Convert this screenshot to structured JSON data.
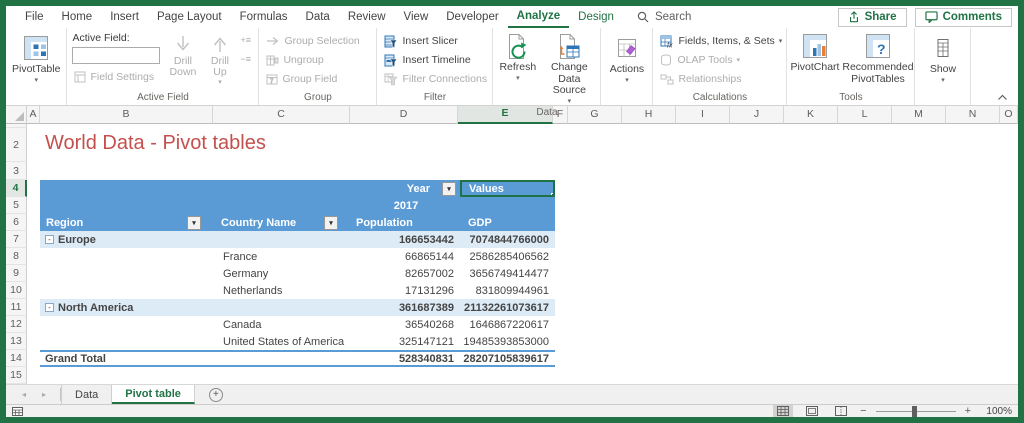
{
  "menu": {
    "tabs": [
      {
        "label": "File"
      },
      {
        "label": "Home"
      },
      {
        "label": "Insert"
      },
      {
        "label": "Page Layout"
      },
      {
        "label": "Formulas"
      },
      {
        "label": "Data"
      },
      {
        "label": "Review"
      },
      {
        "label": "View"
      },
      {
        "label": "Developer"
      },
      {
        "label": "Analyze",
        "active": true
      },
      {
        "label": "Design",
        "contextual": true
      }
    ],
    "search_label": "Search",
    "share_label": "Share",
    "comments_label": "Comments"
  },
  "ribbon": {
    "pivottable": {
      "label": "PivotTable",
      "enabled": true
    },
    "active_field": {
      "group_label": "Active Field",
      "field_label": "Active Field:",
      "field_value": "",
      "field_settings": "Field Settings",
      "field_settings_enabled": false,
      "drill_down": "Drill Down",
      "drill_down_enabled": false,
      "drill_up": "Drill Up",
      "drill_up_enabled": false,
      "expand_field_enabled": false,
      "collapse_field_enabled": false
    },
    "group": {
      "group_label": "Group",
      "selection": "Group Selection",
      "selection_enabled": false,
      "ungroup": "Ungroup",
      "ungroup_enabled": false,
      "field": "Group Field",
      "field_enabled": false
    },
    "filter": {
      "group_label": "Filter",
      "insert_slicer": "Insert Slicer",
      "insert_slicer_enabled": true,
      "insert_timeline": "Insert Timeline",
      "insert_timeline_enabled": true,
      "filter_connections": "Filter Connections",
      "filter_connections_enabled": false
    },
    "data": {
      "group_label": "Data",
      "refresh": "Refresh",
      "refresh_enabled": true,
      "change_data_source": "Change Data Source",
      "change_data_source_enabled": true
    },
    "actions": {
      "label": "Actions",
      "enabled": true
    },
    "calculations": {
      "group_label": "Calculations",
      "fields_items_sets": "Fields, Items, & Sets",
      "fields_items_sets_enabled": true,
      "olap_tools": "OLAP Tools",
      "olap_tools_enabled": false,
      "relationships": "Relationships",
      "relationships_enabled": false
    },
    "tools": {
      "group_label": "Tools",
      "pivotchart": "PivotChart",
      "recommended": "Recommended PivotTables"
    },
    "show": {
      "label": "Show"
    }
  },
  "sheet": {
    "column_headers": [
      "A",
      "B",
      "C",
      "D",
      "E",
      "F",
      "G",
      "H",
      "I",
      "J",
      "K",
      "L",
      "M",
      "N",
      "O"
    ],
    "selected_column": "E",
    "row_numbers": [
      "2",
      "3",
      "4",
      "5",
      "6",
      "7",
      "8",
      "9",
      "10",
      "11",
      "12",
      "13",
      "14",
      "15"
    ],
    "selected_row": "4",
    "title": "World Data - Pivot tables"
  },
  "pivot": {
    "year_label": "Year",
    "values_label": "Values",
    "year_value": "2017",
    "headers": {
      "region": "Region",
      "country": "Country Name",
      "population": "Population",
      "gdp": "GDP"
    },
    "rows": [
      {
        "type": "subtotal",
        "region": "Europe",
        "country": "",
        "population": "166653442",
        "gdp": "7074844766000"
      },
      {
        "type": "detail",
        "region": "",
        "country": "France",
        "population": "66865144",
        "gdp": "2586285406562"
      },
      {
        "type": "detail",
        "region": "",
        "country": "Germany",
        "population": "82657002",
        "gdp": "3656749414477"
      },
      {
        "type": "detail",
        "region": "",
        "country": "Netherlands",
        "population": "17131296",
        "gdp": "831809944961"
      },
      {
        "type": "subtotal",
        "region": "North America",
        "country": "",
        "population": "361687389",
        "gdp": "21132261073617"
      },
      {
        "type": "detail",
        "region": "",
        "country": "Canada",
        "population": "36540268",
        "gdp": "1646867220617"
      },
      {
        "type": "detail",
        "region": "",
        "country": "United States of America",
        "population": "325147121",
        "gdp": "19485393853000"
      },
      {
        "type": "grand",
        "region": "Grand Total",
        "country": "",
        "population": "528340831",
        "gdp": "28207105839617"
      }
    ]
  },
  "sheet_tabs": {
    "tabs": [
      {
        "label": "Data"
      },
      {
        "label": "Pivot table",
        "active": true
      }
    ]
  },
  "status_bar": {
    "zoom_level": "100%"
  },
  "colors": {
    "excel_green": "#217346",
    "pivot_header_blue": "#5B9BD5",
    "pivot_band_blue": "#DDEBF7",
    "title_red": "#C4504E"
  }
}
